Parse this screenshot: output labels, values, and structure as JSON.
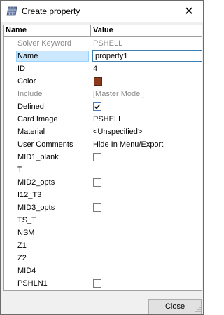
{
  "window": {
    "title": "Create property",
    "title_icon": "property-grid-icon",
    "close_glyph": "✕"
  },
  "grid": {
    "col_name": "Name",
    "col_value": "Value",
    "rows": [
      {
        "name": "Solver Keyword",
        "value": "PSHELL",
        "kind": "text",
        "disabled": true
      },
      {
        "name": "Name",
        "value": "property1",
        "kind": "edit",
        "selected": true
      },
      {
        "name": "ID",
        "value": "4",
        "kind": "text"
      },
      {
        "name": "Color",
        "value": "",
        "kind": "color",
        "color": "#8b3a1e"
      },
      {
        "name": "Include",
        "value": "[Master Model]",
        "kind": "text",
        "disabled": true
      },
      {
        "name": "Defined",
        "value": "",
        "kind": "checkbox",
        "checked": true
      },
      {
        "name": "Card Image",
        "value": "PSHELL",
        "kind": "text"
      },
      {
        "name": "Material",
        "value": "<Unspecified>",
        "kind": "text"
      },
      {
        "name": "User Comments",
        "value": "Hide In Menu/Export",
        "kind": "text"
      },
      {
        "name": "MID1_blank",
        "value": "",
        "kind": "checkbox",
        "checked": false
      },
      {
        "name": "T",
        "value": "",
        "kind": "text"
      },
      {
        "name": "MID2_opts",
        "value": "",
        "kind": "checkbox",
        "checked": false
      },
      {
        "name": "I12_T3",
        "value": "",
        "kind": "text"
      },
      {
        "name": "MID3_opts",
        "value": "",
        "kind": "checkbox",
        "checked": false
      },
      {
        "name": "TS_T",
        "value": "",
        "kind": "text"
      },
      {
        "name": "NSM",
        "value": "",
        "kind": "text"
      },
      {
        "name": "Z1",
        "value": "",
        "kind": "text"
      },
      {
        "name": "Z2",
        "value": "",
        "kind": "text"
      },
      {
        "name": "MID4",
        "value": "",
        "kind": "text"
      },
      {
        "name": "PSHLN1",
        "value": "",
        "kind": "checkbox",
        "checked": false
      }
    ]
  },
  "footer": {
    "close_label": "Close"
  }
}
